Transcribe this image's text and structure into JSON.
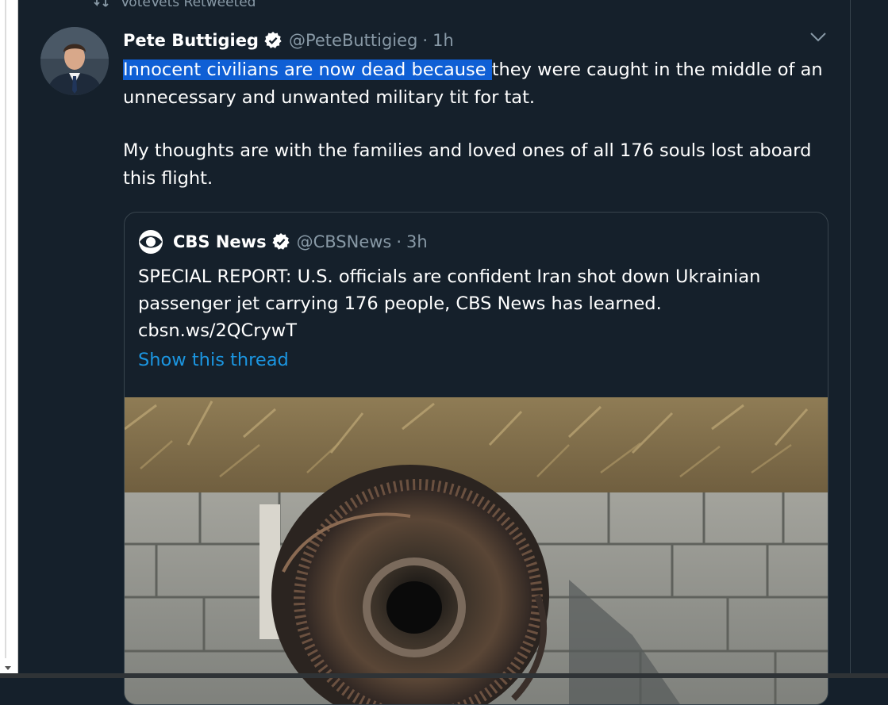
{
  "retweet": {
    "icon": "retweet-icon",
    "text": "VoteVets Retweeted"
  },
  "tweet": {
    "avatar_icon": "author-avatar",
    "author_name": "Pete Buttigieg",
    "verified_icon": "verified-badge-icon",
    "handle": "@PeteButtigieg",
    "separator": "·",
    "timestamp": "1h",
    "menu_icon": "chevron-down-icon",
    "text": {
      "highlighted": "Innocent civilians are now dead because ",
      "rest_line1": "they were caught in the middle of an unnecessary and unwanted military tit for tat.",
      "paragraph2": "My thoughts are with the families and loved ones of all 176 souls lost aboard this flight."
    }
  },
  "quoted_tweet": {
    "logo_icon": "cbs-eye-logo",
    "author_name": "CBS News",
    "verified_icon": "verified-badge-icon",
    "handle": "@CBSNews",
    "separator": "·",
    "timestamp": "3h",
    "text_line1": "SPECIAL REPORT: U.S. officials are confident Iran shot down Ukrainian",
    "text_line2": "passenger jet carrying 176 people, CBS News has learned.",
    "text_line3": "cbsn.ws/2QCrywT",
    "thread_link": "Show this thread",
    "media_icon": "debris-photo"
  },
  "colors": {
    "background": "#15202b",
    "text_primary": "#ffffff",
    "text_secondary": "#8899a6",
    "link": "#1b95e0",
    "selection": "#0f5fd5",
    "border": "#38444d"
  }
}
